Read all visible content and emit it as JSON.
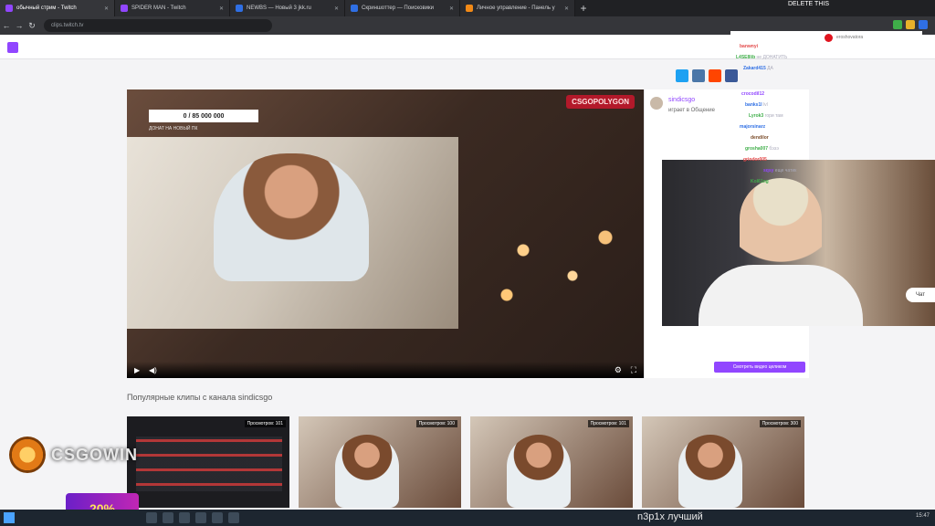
{
  "browser": {
    "tabs": [
      {
        "label": "обычный стрим - Twitch",
        "color": "#9146ff"
      },
      {
        "label": "SPIDER MAN - Twitch",
        "color": "#9146ff"
      },
      {
        "label": "NEWBS — Новый 3 jkk.ru",
        "color": "#2f6fe4"
      },
      {
        "label": "Скриншоттер — Поисковики",
        "color": "#2f6fe4"
      },
      {
        "label": "Личное управление - Панель у",
        "color": "#f28a17"
      }
    ],
    "url": "clips.twitch.tv"
  },
  "player": {
    "goal_text": "0 / 85 000 000",
    "goal_sub": "ДОНАТ НА НОВЫЙ ПК",
    "brand": "CSGOPOLYGON"
  },
  "card": {
    "channel": "sindicsgo",
    "subtitle": "играет в Общение",
    "button_label": "Смотреть видео целиком"
  },
  "chat": {
    "delete_tag": "DELETE THIS",
    "lines": [
      {
        "name": "banwnyi",
        "text": "",
        "color": "#e34a4a"
      },
      {
        "name": "L4SE8lib",
        "text": "не ДОНАТИТЬ",
        "color": "#3fae49"
      },
      {
        "name": "Zakard415",
        "text": "ДА",
        "color": "#2f6fe4"
      },
      {
        "name": "crocodil12",
        "text": "",
        "color": "#9146ff"
      },
      {
        "name": "banks1l",
        "text": "lvl",
        "color": "#2f6fe4"
      },
      {
        "name": "Lyrok3",
        "text": "гори там",
        "color": "#3fae49"
      },
      {
        "name": "majorsinarz",
        "text": "",
        "color": "#2f6fe4"
      },
      {
        "name": "dendilor",
        "text": "",
        "color": "#7b4c2a"
      },
      {
        "name": "grosha007",
        "text": "бэээ",
        "color": "#3fae49"
      },
      {
        "name": "grindor005",
        "text": "",
        "color": "#e34a4a"
      },
      {
        "name": "sqsy",
        "text": "еще чатик",
        "color": "#9146ff"
      },
      {
        "name": "Kol61ng",
        "text": "",
        "color": "#3fae49"
      }
    ]
  },
  "donation_name": "eroshovatora",
  "webcam": {
    "pill": "Чат"
  },
  "clips": {
    "section_title": "Популярные клипы с канала sindicsgo",
    "items": [
      {
        "views": "Просмотров: 101"
      },
      {
        "views": "Просмотров: 100"
      },
      {
        "views": "Просмотров: 101"
      },
      {
        "views": "Просмотров: 300"
      }
    ]
  },
  "overlay": {
    "csgowin": "CSGOWIN",
    "promo": "20%"
  },
  "taskbar": {
    "subtitle": "n3p1x лучший",
    "clock": "15:47"
  }
}
